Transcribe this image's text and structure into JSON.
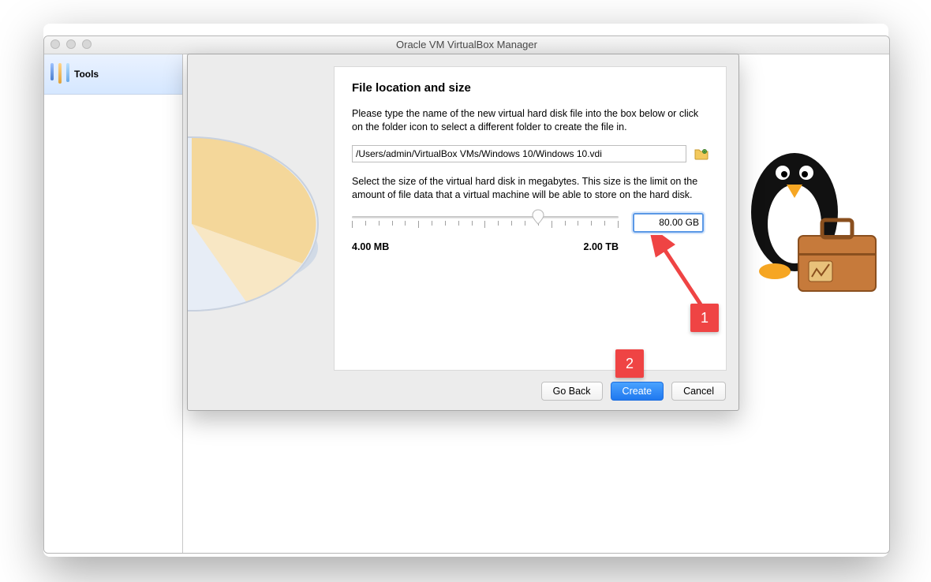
{
  "window": {
    "title": "Oracle VM VirtualBox Manager"
  },
  "sidebar": {
    "tools_label": "Tools"
  },
  "sheet": {
    "heading": "File location and size",
    "desc1": "Please type the name of the new virtual hard disk file into the box below or click on the folder icon to select a different folder to create the file in.",
    "path_value": "/Users/admin/VirtualBox VMs/Windows 10/Windows 10.vdi",
    "desc2": "Select the size of the virtual hard disk in megabytes. This size is the limit on the amount of file data that a virtual machine will be able to store on the hard disk.",
    "size_value": "80.00 GB",
    "min_label": "4.00 MB",
    "max_label": "2.00 TB",
    "buttons": {
      "back": "Go Back",
      "create": "Create",
      "cancel": "Cancel"
    }
  },
  "annotations": {
    "callout1": "1",
    "callout2": "2"
  }
}
